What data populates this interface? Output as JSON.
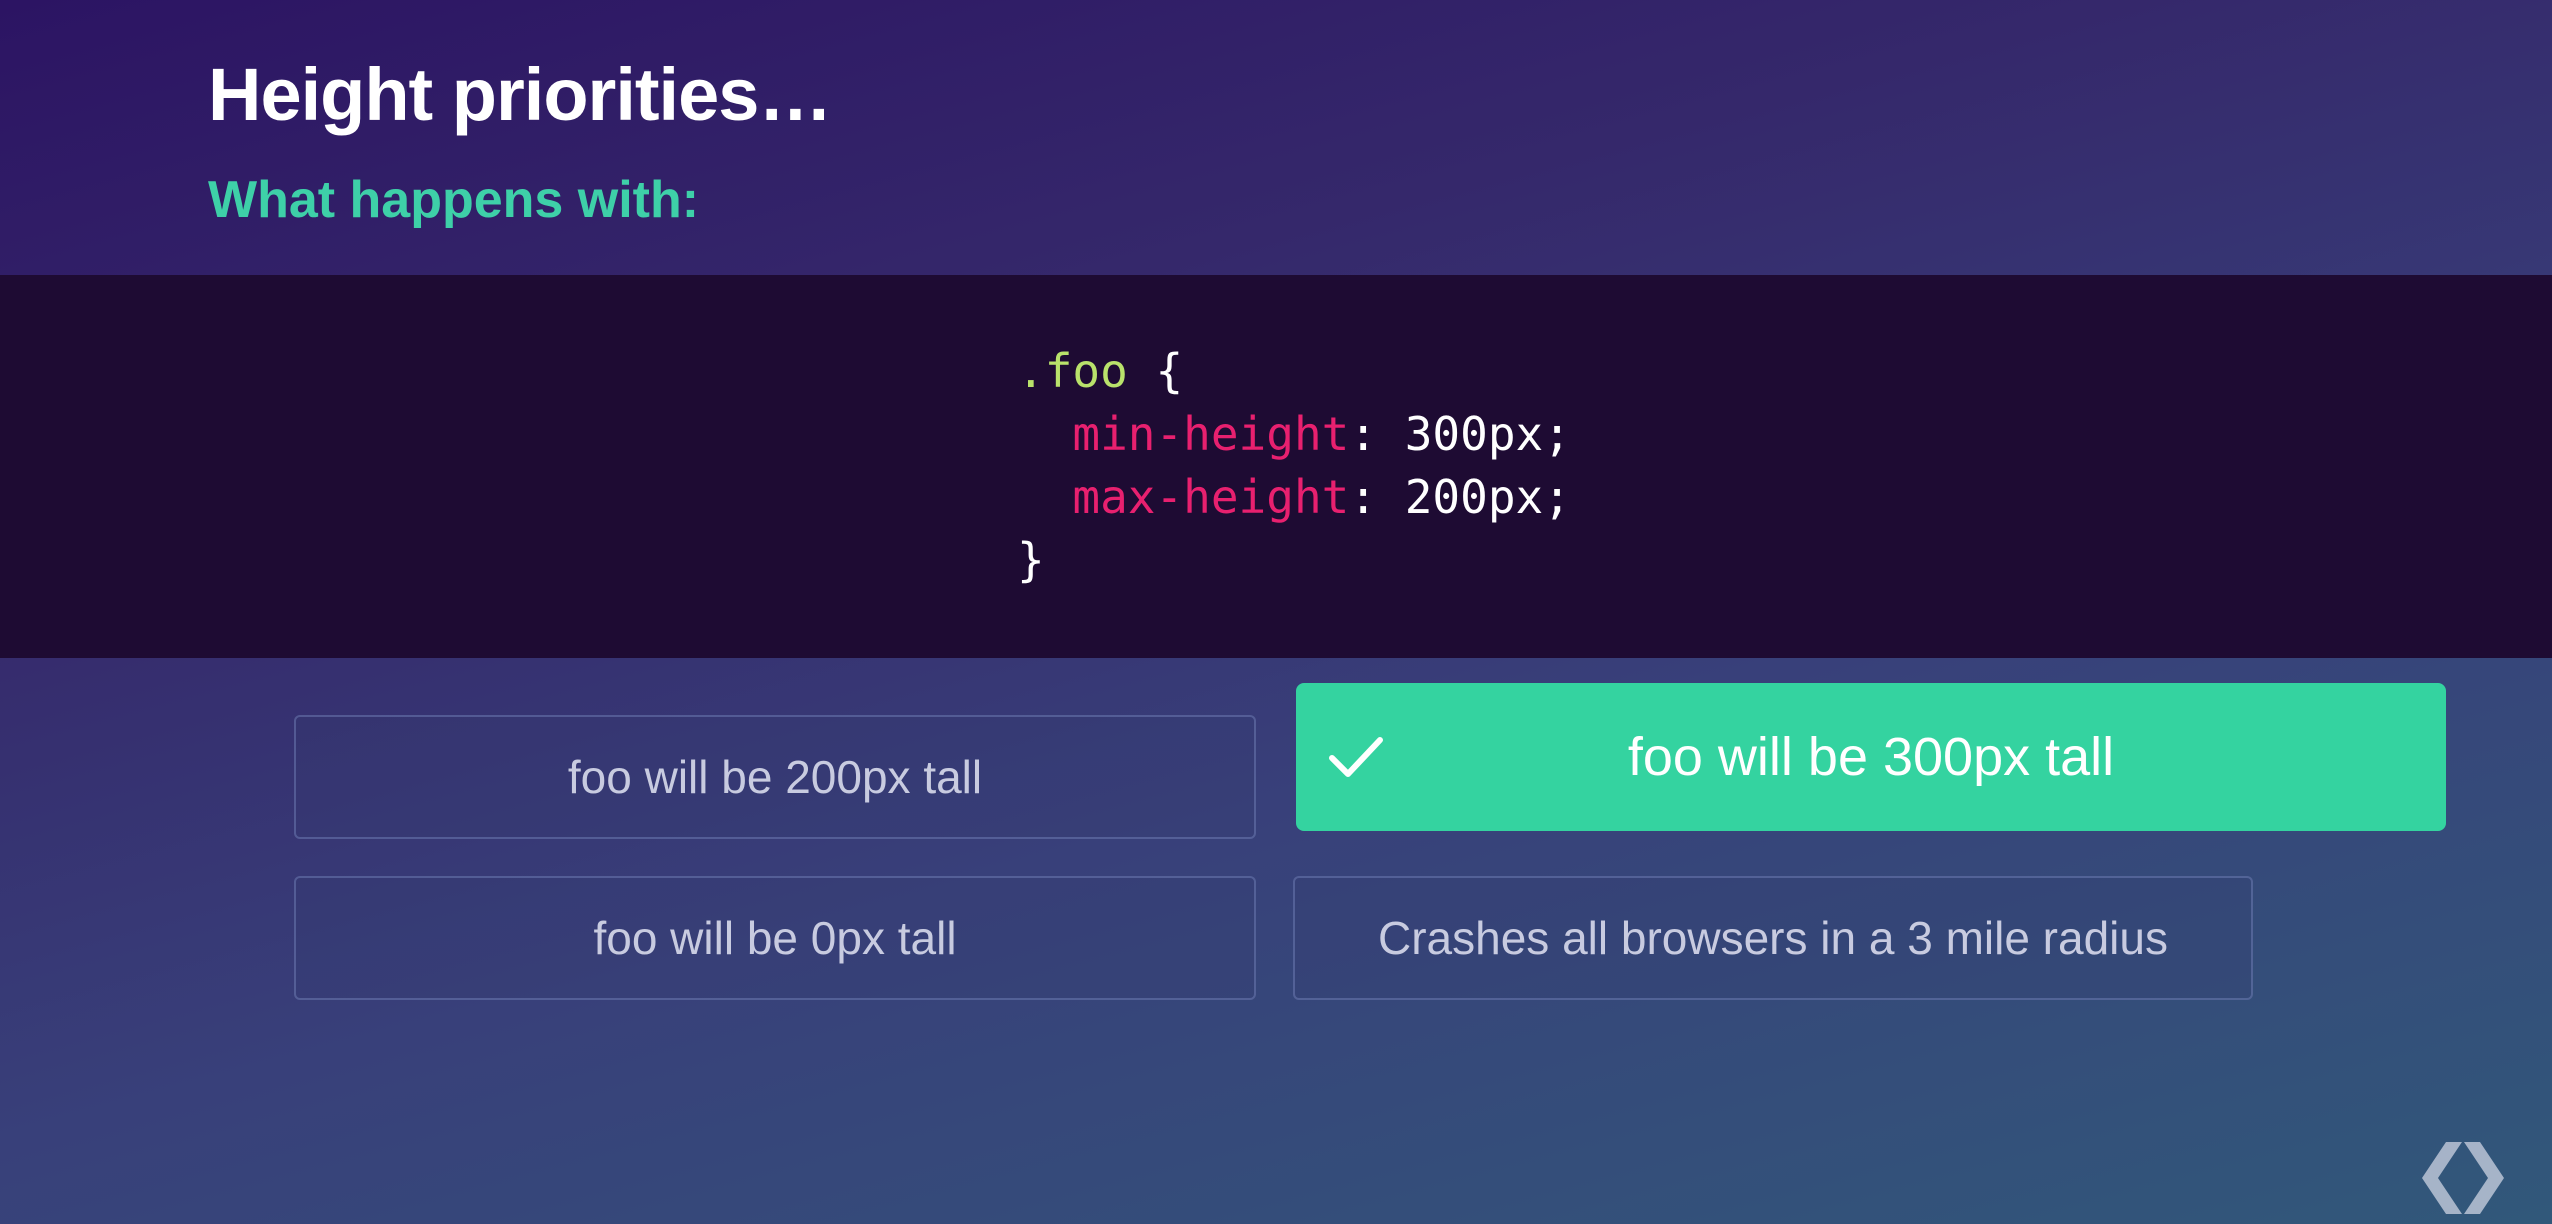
{
  "slide": {
    "title": "Height priorities…",
    "subtitle": "What happens with:"
  },
  "code": {
    "selector": ".foo",
    "open_brace": " {",
    "rules": [
      {
        "property": "min-height",
        "value": ": 300px;"
      },
      {
        "property": "max-height",
        "value": ": 200px;"
      }
    ],
    "close_brace": "}"
  },
  "answers": [
    {
      "label": "foo will be 200px tall",
      "correct": false
    },
    {
      "label": "foo will be 300px tall",
      "correct": true
    },
    {
      "label": "foo will be 0px tall",
      "correct": false
    },
    {
      "label": "Crashes all browsers in a 3 mile radius",
      "correct": false
    }
  ],
  "icons": {
    "correct_marker": "checkmark-icon",
    "brand": "chrome-developers-logo-icon"
  },
  "colors": {
    "title": "#ffffff",
    "subtitle": "#3ed0a8",
    "code_background": "#1e0b33",
    "code_selector": "#b9e26b",
    "code_property": "#e8206f",
    "correct_answer": "#34d3a0"
  }
}
